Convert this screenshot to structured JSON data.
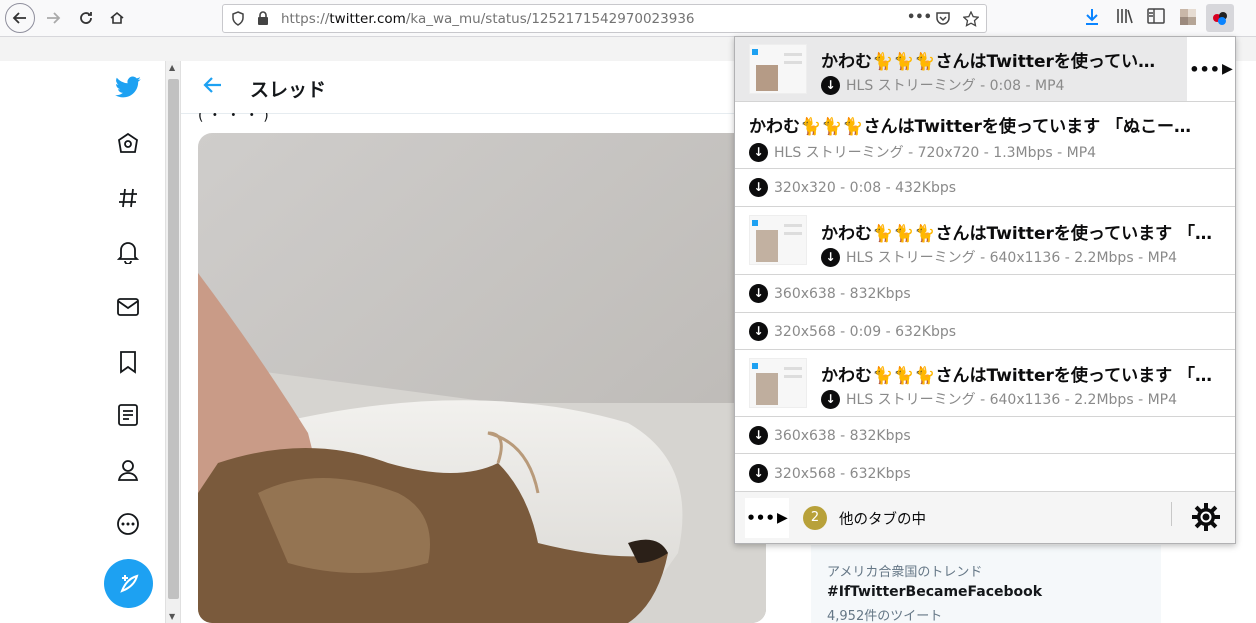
{
  "browser": {
    "url_prefix": "https://",
    "url_host": "twitter.com",
    "url_path": "/ka_wa_mu/status/1252171542970023936",
    "page_actions": "•••"
  },
  "twitter": {
    "header_title": "スレッド",
    "partial_caption": "( ・ ・ ・ )",
    "nav_icons": [
      "twitter-logo-icon",
      "home-icon",
      "explore-hashtag-icon",
      "notifications-bell-icon",
      "messages-envelope-icon",
      "bookmark-icon",
      "lists-icon",
      "profile-icon",
      "more-circle-icon",
      "compose-tweet-icon"
    ],
    "trend": {
      "label": "アメリカ合衆国のトレンド",
      "tag": "#IfTwitterBecameFacebook",
      "count": "4,952件のツイート"
    }
  },
  "popup": {
    "items": [
      {
        "title": "かわむ🐈🐈🐈さんはTwitterを使ってい…",
        "sub": "HLS ストリーミング - 0:08 - MP4"
      },
      {
        "title": "かわむ🐈🐈🐈さんはTwitterを使っています 「ぬこー…",
        "sub": "HLS ストリーミング - 720x720 - 1.3Mbps - MP4"
      },
      {
        "sub": "320x320 - 0:08 - 432Kbps"
      },
      {
        "title": "かわむ🐈🐈🐈さんはTwitterを使っています 「…",
        "sub": "HLS ストリーミング - 640x1136 - 2.2Mbps - MP4"
      },
      {
        "sub": "360x638 - 832Kbps"
      },
      {
        "sub": "320x568 - 0:09 - 632Kbps"
      },
      {
        "title": "かわむ🐈🐈🐈さんはTwitterを使っています 「…",
        "sub": "HLS ストリーミング - 640x1136 - 2.2Mbps - MP4"
      },
      {
        "sub": "360x638 - 832Kbps"
      },
      {
        "sub": "320x568 - 632Kbps"
      }
    ],
    "footer": {
      "badge": "2",
      "text": "他のタブの中",
      "more": "•••"
    }
  }
}
